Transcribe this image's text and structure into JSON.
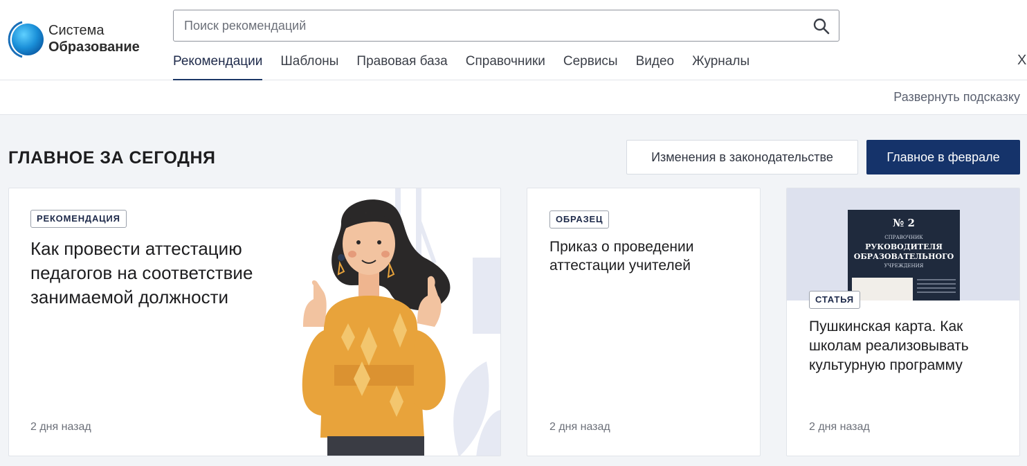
{
  "logo": {
    "line1": "Система",
    "line2": "Образование"
  },
  "search": {
    "placeholder": "Поиск рекомендаций"
  },
  "nav": {
    "items": [
      {
        "label": "Рекомендации",
        "active": true
      },
      {
        "label": "Шаблоны"
      },
      {
        "label": "Правовая база"
      },
      {
        "label": "Справочники"
      },
      {
        "label": "Сервисы"
      },
      {
        "label": "Видео"
      },
      {
        "label": "Журналы"
      }
    ],
    "close_label": "Х"
  },
  "hint": {
    "expand_label": "Развернуть подсказку"
  },
  "section": {
    "title": "ГЛАВНОЕ ЗА СЕГОДНЯ",
    "btn_changes": "Изменения в законодательстве",
    "btn_main": "Главное в феврале"
  },
  "cards": [
    {
      "badge": "РЕКОМЕНДАЦИЯ",
      "title": "Как провести аттестацию педагогов на соответствие занимаемой должности",
      "time": "2 дня назад"
    },
    {
      "badge": "ОБРАЗЕЦ",
      "title": "Приказ о проведении аттестации учителей",
      "time": "2 дня назад"
    },
    {
      "badge": "СТАТЬЯ",
      "title": "Пушкинская карта. Как школам реализовывать культурную программу",
      "time": "2 дня назад",
      "cover": {
        "number": "№ 2",
        "top_label": "СПРАВОЧНИК",
        "title_line1": "РУКОВОДИТЕЛЯ",
        "title_line2": "ОБРАЗОВАТЕЛЬНОГО",
        "bottom_label": "УЧРЕЖДЕНИЯ"
      }
    }
  ],
  "colors": {
    "primary": "#15336a",
    "background": "#f2f4f7",
    "accent_orange": "#e8a33b"
  }
}
